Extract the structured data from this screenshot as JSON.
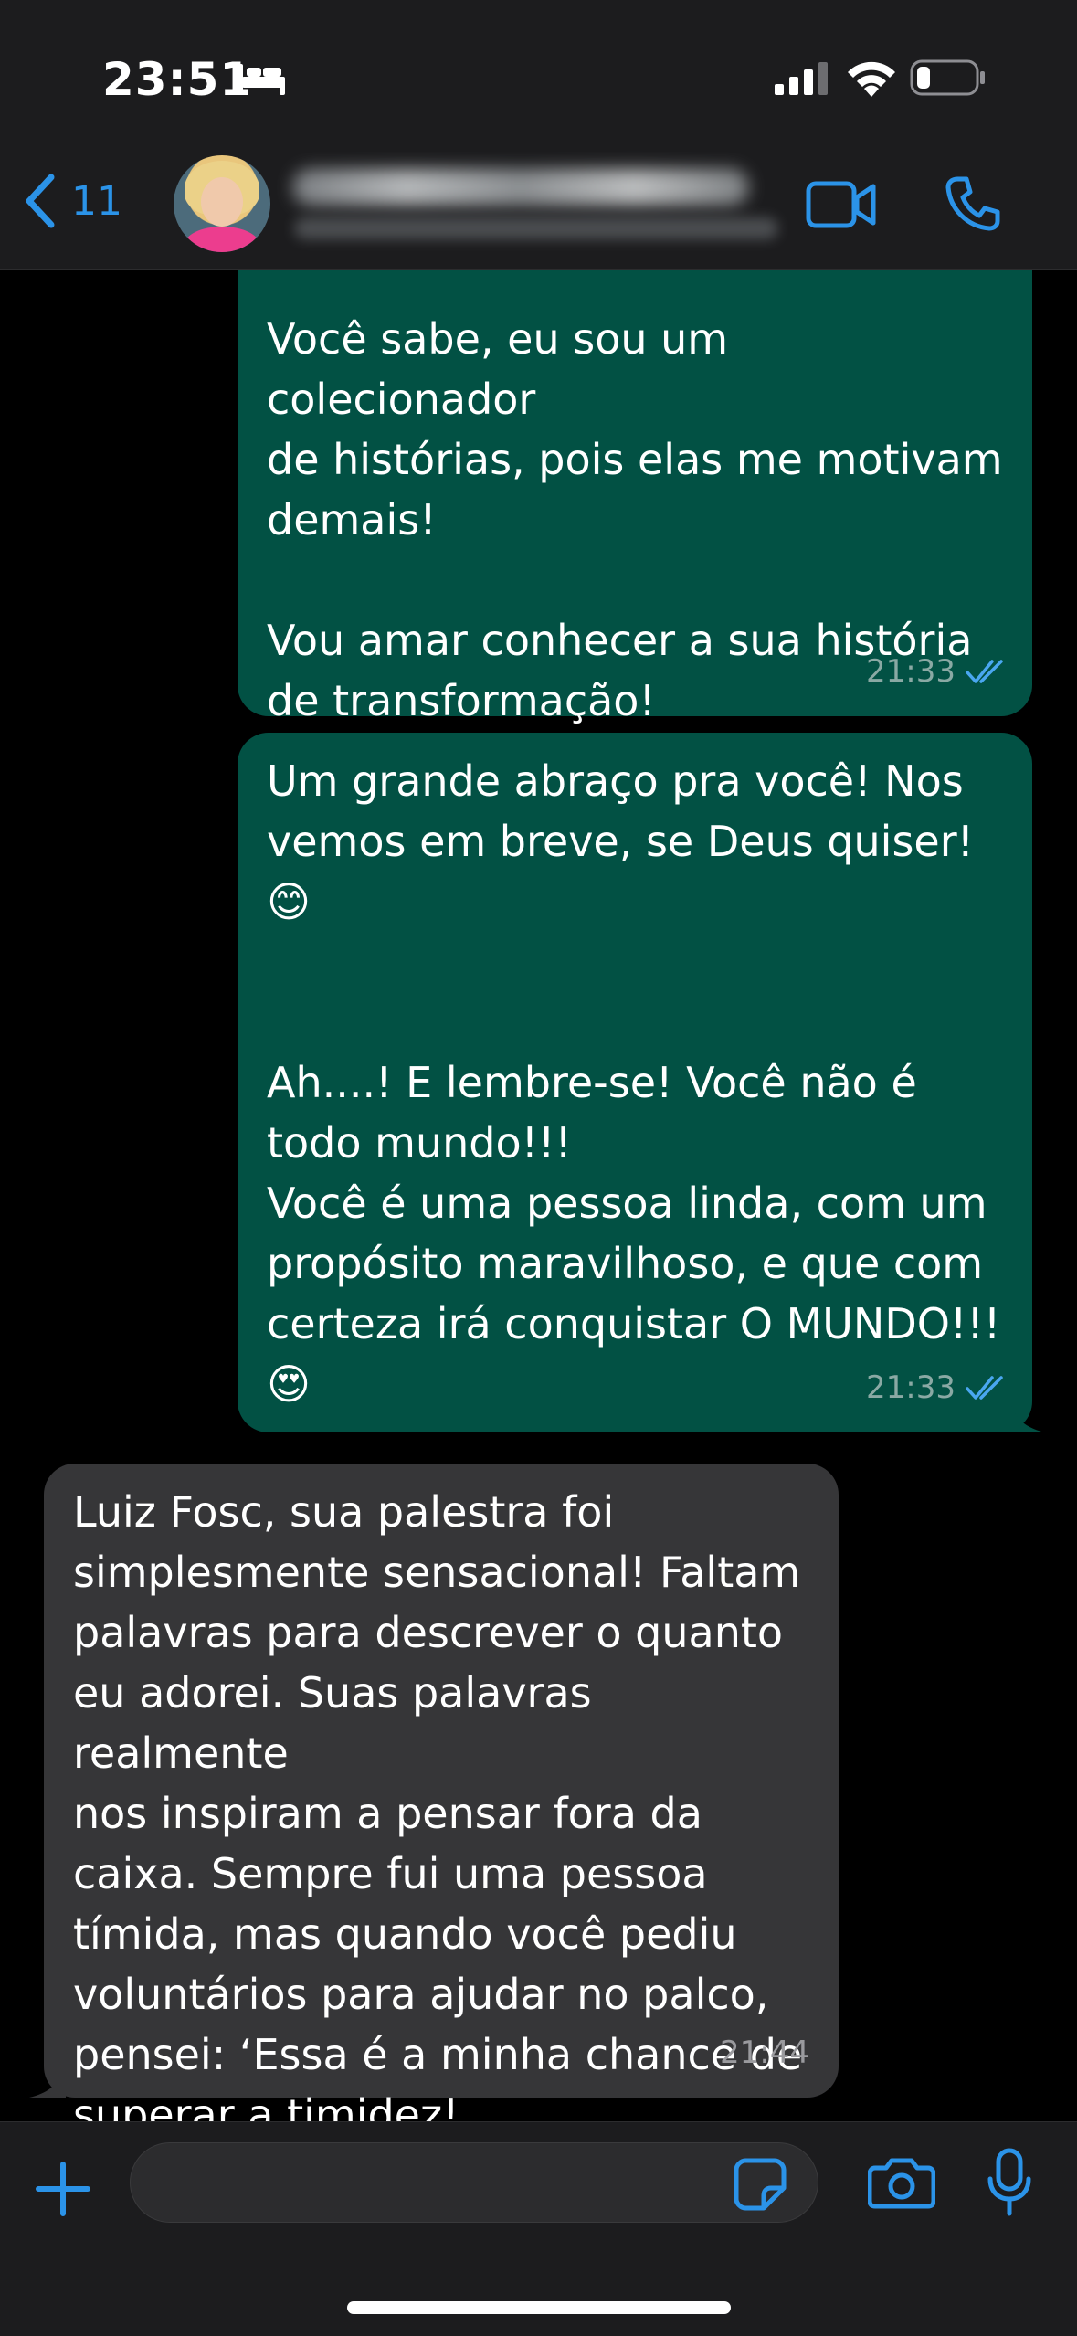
{
  "status_bar": {
    "time": "23:51"
  },
  "header": {
    "back_count": "11"
  },
  "messages": [
    {
      "direction": "outgoing",
      "text": "Você sabe, eu sou um colecionador\nde histórias, pois elas me motivam\ndemais!\n\nVou amar conhecer a sua história\nde transformação!",
      "time": "21:33"
    },
    {
      "direction": "outgoing",
      "text": "Um grande abraço pra você! Nos\nvemos em breve, se Deus quiser!\n😊\n\n\nAh....! E lembre-se! Você não é\ntodo mundo!!!\nVocê é uma pessoa linda, com um\npropósito maravilhoso, e que com\ncerteza irá conquistar O MUNDO!!!\n😍",
      "time": "21:33"
    },
    {
      "direction": "incoming",
      "text": "Luiz Fosc, sua palestra foi\nsimplesmente sensacional! Faltam\npalavras para descrever o quanto\neu adorei. Suas palavras realmente\nnos inspiram a pensar fora da\ncaixa. Sempre fui uma pessoa\ntímida, mas quando você pediu\nvoluntários para ajudar no palco,\npensei: ‘Essa é a minha chance de\nsuperar a timidez!",
      "time": "21:44"
    }
  ],
  "input": {
    "placeholder": ""
  },
  "colors": {
    "accent": "#2b93e8",
    "outgoing_bubble": "#025144",
    "incoming_bubble": "#363638"
  },
  "icons": [
    "bed-icon",
    "signal-icon",
    "wifi-icon",
    "battery-icon",
    "chevron-left-icon",
    "video-call-icon",
    "phone-icon",
    "plus-icon",
    "sticker-icon",
    "camera-icon",
    "microphone-icon",
    "double-check-icon"
  ]
}
